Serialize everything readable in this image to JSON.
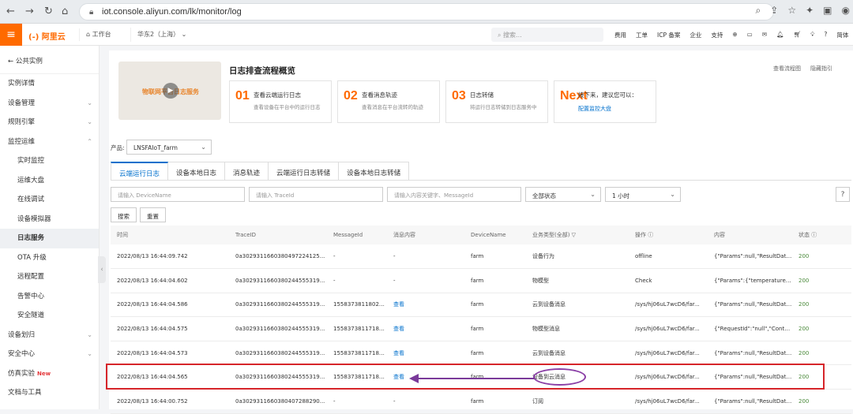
{
  "browser": {
    "url": "iot.console.aliyun.com/lk/monitor/log"
  },
  "topbar": {
    "logo": "(-) 阿里云",
    "workspace": "工作台",
    "region": "华东2（上海）",
    "search_placeholder": "搜索...",
    "links": [
      "费用",
      "工单",
      "ICP 备案",
      "企业",
      "支持",
      "App",
      "简体"
    ]
  },
  "sidebar": {
    "back_label": "公共实例",
    "items": [
      {
        "label": "实例详情",
        "sub": false,
        "chev": ""
      },
      {
        "label": "设备管理",
        "sub": false,
        "chev": "⌄"
      },
      {
        "label": "规则引擎",
        "sub": false,
        "chev": "⌄"
      },
      {
        "label": "监控运维",
        "sub": false,
        "chev": "⌃"
      },
      {
        "label": "实时监控",
        "sub": true,
        "chev": ""
      },
      {
        "label": "运维大盘",
        "sub": true,
        "chev": ""
      },
      {
        "label": "在线调试",
        "sub": true,
        "chev": ""
      },
      {
        "label": "设备模拟器",
        "sub": true,
        "chev": ""
      },
      {
        "label": "日志服务",
        "sub": true,
        "chev": "",
        "active": true
      },
      {
        "label": "OTA 升级",
        "sub": true,
        "chev": ""
      },
      {
        "label": "远程配置",
        "sub": true,
        "chev": ""
      },
      {
        "label": "告警中心",
        "sub": true,
        "chev": ""
      },
      {
        "label": "安全隧道",
        "sub": true,
        "chev": ""
      },
      {
        "label": "设备划归",
        "sub": false,
        "chev": "⌄"
      },
      {
        "label": "安全中心",
        "sub": false,
        "chev": "⌄"
      },
      {
        "label": "仿真实验",
        "sub": false,
        "chev": "",
        "badge": "New"
      },
      {
        "label": "文档与工具",
        "sub": false,
        "chev": ""
      }
    ]
  },
  "overview": {
    "video_label": "物联网平台日志服务",
    "title": "日志排查流程概览",
    "links": [
      "查看流程图",
      "隐藏指引"
    ],
    "cards": [
      {
        "num": "01",
        "title": "查看云端运行日志",
        "desc": "查看设备在平台中的运行日志"
      },
      {
        "num": "02",
        "title": "查看消息轨迹",
        "desc": "查看消息在平台流转的轨迹"
      },
      {
        "num": "03",
        "title": "日志转储",
        "desc": "将运行日志转储到日志服务中"
      },
      {
        "num": "Next",
        "title": "接下来，建议您可以：",
        "desc": "",
        "link": "配置监控大盘"
      }
    ]
  },
  "filters": {
    "product_label": "产品:",
    "product_value": "LNSFAIoT_farm",
    "tabs": [
      "云端运行日志",
      "设备本地日志",
      "消息轨迹",
      "云端运行日志转储",
      "设备本地日志转储"
    ],
    "device_placeholder": "请输入 DeviceName",
    "trace_placeholder": "请输入 TraceId",
    "content_placeholder": "请输入内容关键字、MessageId",
    "status_value": "全部状态",
    "time_value": "1 小时",
    "search_btn": "搜索",
    "reset_btn": "重置"
  },
  "table": {
    "columns": [
      "时间",
      "TraceID",
      "MessageId",
      "消息内容",
      "DeviceName",
      "业务类型(全部) ▽",
      "操作 ⓘ",
      "内容",
      "状态 ⓘ"
    ],
    "rows": [
      [
        "2022/08/13 16:44:09.742",
        "0a3029311660380497224125...",
        "-",
        "-",
        "farm",
        "设备行为",
        "offline",
        "{\"Params\":null,\"ResultData...",
        "200"
      ],
      [
        "2022/08/13 16:44:04.602",
        "0a3029311660380244555319...",
        "-",
        "-",
        "farm",
        "物模型",
        "Check",
        "{\"Params\":{\"temperature\"...",
        "200"
      ],
      [
        "2022/08/13 16:44:04.586",
        "0a3029311660380244555319...",
        "15583738118027...",
        "查看",
        "farm",
        "云到设备消息",
        "/sys/hj06uL7wcD6/far...",
        "{\"Params\":null,\"ResultData...",
        "200"
      ],
      [
        "2022/08/13 16:44:04.575",
        "0a3029311660380244555319...",
        "15583738117183...",
        "查看",
        "farm",
        "物模型消息",
        "/sys/hj06uL7wcD6/far...",
        "{\"RequestId\":\"null\",\"Conte...",
        "200"
      ],
      [
        "2022/08/13 16:44:04.573",
        "0a3029311660380244555319...",
        "15583738117183...",
        "查看",
        "farm",
        "云到设备消息",
        "/sys/hj06uL7wcD6/far...",
        "{\"Params\":null,\"ResultData...",
        "200"
      ],
      [
        "2022/08/13 16:44:04.565",
        "0a3029311660380244555319...",
        "15583738117183...",
        "查看",
        "farm",
        "设备到云消息",
        "/sys/hj06uL7wcD6/far...",
        "{\"Params\":null,\"ResultData...",
        "200"
      ],
      [
        "2022/08/13 16:44:00.752",
        "0a3029311660380407288290...",
        "-",
        "-",
        "farm",
        "订阅",
        "/sys/hj06uL7wcD6/far...",
        "{\"Params\":null,\"ResultData...",
        "200"
      ]
    ]
  }
}
